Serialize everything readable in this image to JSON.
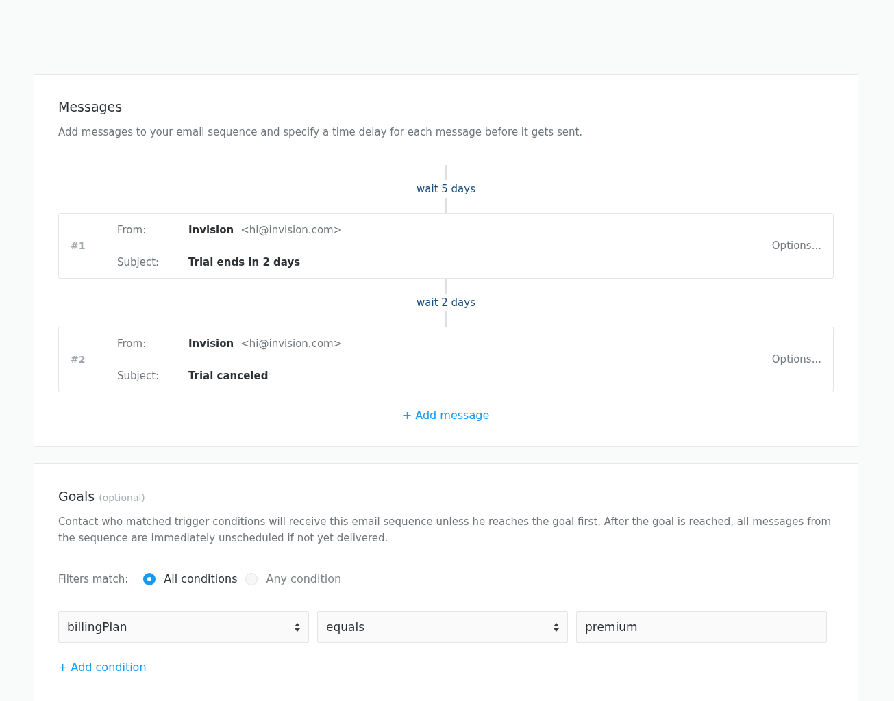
{
  "messages_section": {
    "title": "Messages",
    "description": "Add messages to your email sequence and specify a time delay for each message before it gets sent.",
    "messages": [
      {
        "wait": "wait 5 days",
        "number": "#1",
        "from_label": "From:",
        "from_name": "Invision",
        "from_email": "<hi@invision.com>",
        "subject_label": "Subject:",
        "subject": "Trial ends in 2 days",
        "options": "Options..."
      },
      {
        "wait": "wait 2 days",
        "number": "#2",
        "from_label": "From:",
        "from_name": "Invision",
        "from_email": "<hi@invision.com>",
        "subject_label": "Subject:",
        "subject": "Trial canceled",
        "options": "Options..."
      }
    ],
    "add_message": "+ Add message"
  },
  "goals_section": {
    "title": "Goals",
    "optional": "(optional)",
    "description": "Contact who matched trigger conditions will receive this email sequence unless he reaches the goal first. After the goal is reached, all messages from the sequence are immediately unscheduled if not yet delivered.",
    "filters_label": "Filters match:",
    "filter_options": [
      {
        "label": "All conditions",
        "selected": true
      },
      {
        "label": "Any condition",
        "selected": false
      }
    ],
    "condition_fields": [
      {
        "kind": "select",
        "value": "billingPlan"
      },
      {
        "kind": "select",
        "value": "equals"
      },
      {
        "kind": "text",
        "value": "premium"
      }
    ],
    "add_condition": "+ Add condition"
  }
}
